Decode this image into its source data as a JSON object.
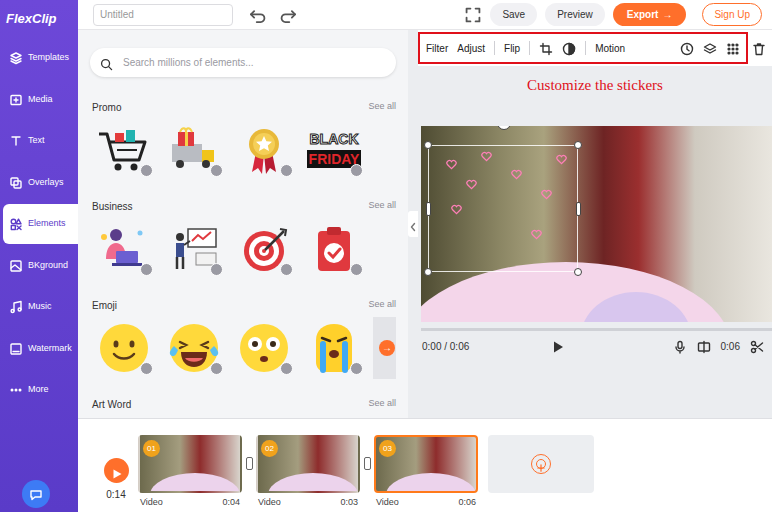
{
  "header": {
    "logo": "FlexClip",
    "project_title": "Untitled",
    "buttons": [
      {
        "label": "Save",
        "kind": "plain"
      },
      {
        "label": "Preview",
        "kind": "plain"
      },
      {
        "label": "Export",
        "kind": "primary",
        "icon": "→"
      },
      {
        "label": "Sign Up",
        "kind": "outline"
      }
    ]
  },
  "sidebar": {
    "items": [
      {
        "label": "Templates",
        "selected": false
      },
      {
        "label": "Media",
        "selected": false
      },
      {
        "label": "Text",
        "selected": false
      },
      {
        "label": "Overlays",
        "selected": false
      },
      {
        "label": "Elements",
        "selected": true
      },
      {
        "label": "BKground",
        "selected": false
      },
      {
        "label": "Music",
        "selected": false
      },
      {
        "label": "Watermark",
        "selected": false
      },
      {
        "label": "More",
        "selected": false
      }
    ]
  },
  "panel": {
    "search": {
      "placeholder": "Search millions of elements..."
    },
    "sections": [
      {
        "title": "Promo",
        "see_all": "See all",
        "stickers": [
          {
            "kind": "cart"
          },
          {
            "kind": "gifttruck"
          },
          {
            "kind": "medal"
          },
          {
            "kind": "textart",
            "lines": [
              "BLACK",
              "FRIDAY"
            ]
          },
          {
            "kind": "partial"
          }
        ]
      },
      {
        "title": "Business",
        "see_all": "See all",
        "stickers": [
          {
            "kind": "laptopman"
          },
          {
            "kind": "presenter"
          },
          {
            "kind": "target"
          },
          {
            "kind": "clipboard"
          },
          {
            "kind": "partial"
          }
        ]
      },
      {
        "title": "Emoji",
        "see_all": "See all",
        "next_arrow": "→",
        "stickers": [
          {
            "kind": "smile"
          },
          {
            "kind": "laugh"
          },
          {
            "kind": "surprised"
          },
          {
            "kind": "crying"
          }
        ]
      },
      {
        "title": "Art Word",
        "see_all": "See all",
        "stickers": []
      }
    ]
  },
  "toolbar": {
    "annotation": "Customize the stickers",
    "items": [
      {
        "kind": "text",
        "label": "Filter"
      },
      {
        "kind": "text",
        "label": "Adjust"
      },
      {
        "kind": "separator"
      },
      {
        "kind": "text",
        "label": "Flip"
      },
      {
        "kind": "separator"
      },
      {
        "kind": "crop"
      },
      {
        "kind": "mask"
      },
      {
        "kind": "separator"
      },
      {
        "kind": "text",
        "label": "Motion"
      },
      {
        "kind": "clock"
      },
      {
        "kind": "layers"
      },
      {
        "kind": "grid"
      }
    ],
    "trailing": [
      {
        "kind": "trash"
      }
    ]
  },
  "player": {
    "time": "0:00 / 0:06",
    "duration": "0:06",
    "level": 0
  },
  "timeline": {
    "total": "0:14",
    "clips": [
      {
        "badge": "01",
        "type": "Video",
        "duration": "0:04",
        "selected": false
      },
      {
        "badge": "02",
        "type": "Video",
        "duration": "0:03",
        "selected": false
      },
      {
        "badge": "03",
        "type": "Video",
        "duration": "0:06",
        "selected": true
      }
    ]
  }
}
